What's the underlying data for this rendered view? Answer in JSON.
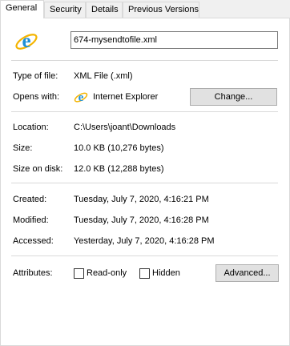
{
  "tabs": [
    {
      "label": "General",
      "active": true
    },
    {
      "label": "Security",
      "active": false
    },
    {
      "label": "Details",
      "active": false
    },
    {
      "label": "Previous Versions",
      "active": false
    }
  ],
  "file": {
    "name": "674-mysendtofile.xml",
    "icon": "internet-explorer-icon"
  },
  "info": {
    "type_label": "Type of file:",
    "type_value": "XML File (.xml)",
    "opens_label": "Opens with:",
    "opens_value": "Internet Explorer",
    "change_button": "Change...",
    "location_label": "Location:",
    "location_value": "C:\\Users\\joant\\Downloads",
    "size_label": "Size:",
    "size_value": "10.0 KB (10,276 bytes)",
    "size_disk_label": "Size on disk:",
    "size_disk_value": "12.0 KB (12,288 bytes)",
    "created_label": "Created:",
    "created_value": "Tuesday, July 7, 2020, 4:16:21 PM",
    "modified_label": "Modified:",
    "modified_value": "Tuesday, July 7, 2020, 4:16:28 PM",
    "accessed_label": "Accessed:",
    "accessed_value": "Yesterday, July 7, 2020, 4:16:28 PM"
  },
  "attributes": {
    "label": "Attributes:",
    "readonly_label": "Read-only",
    "readonly_checked": false,
    "hidden_label": "Hidden",
    "hidden_checked": false,
    "advanced_button": "Advanced..."
  },
  "colors": {
    "ie_blue": "#1e90d8",
    "ie_ring": "#f4b400"
  }
}
